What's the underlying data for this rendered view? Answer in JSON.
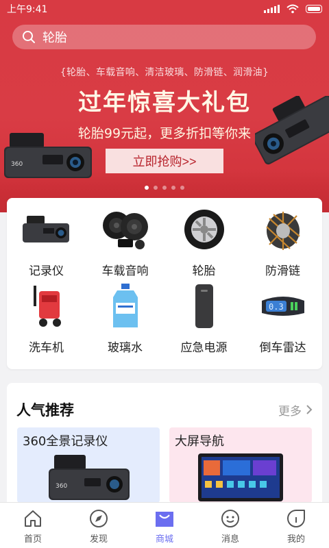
{
  "statusbar": {
    "time": "上午9:41"
  },
  "search": {
    "text": "轮胎",
    "icon": "search-icon"
  },
  "banner": {
    "tags": "{轮胎、车载音响、清洁玻璃、防滑链、润滑油}",
    "title": "过年惊喜大礼包",
    "subtitle": "轮胎99元起，更多折扣等你来",
    "cta": "立即抢购>>",
    "slide_count": 5,
    "active_slide": 1
  },
  "categories": [
    {
      "label": "记录仪",
      "icon": "dashcam-icon"
    },
    {
      "label": "车载音响",
      "icon": "speaker-icon"
    },
    {
      "label": "轮胎",
      "icon": "tire-icon"
    },
    {
      "label": "防滑链",
      "icon": "snow-chain-icon"
    },
    {
      "label": "洗车机",
      "icon": "pressure-washer-icon"
    },
    {
      "label": "玻璃水",
      "icon": "washer-fluid-icon"
    },
    {
      "label": "应急电源",
      "icon": "power-bank-icon"
    },
    {
      "label": "倒车雷达",
      "icon": "parking-sensor-icon"
    }
  ],
  "recommend": {
    "title": "人气推荐",
    "more": "更多",
    "items": [
      {
        "label": "360全景记录仪"
      },
      {
        "label": "大屏导航"
      }
    ]
  },
  "tabs": [
    {
      "label": "首页",
      "icon": "home-icon",
      "active": false
    },
    {
      "label": "发现",
      "icon": "compass-icon",
      "active": false
    },
    {
      "label": "商城",
      "icon": "shopping-bag-icon",
      "active": true
    },
    {
      "label": "消息",
      "icon": "chat-icon",
      "active": false
    },
    {
      "label": "我的",
      "icon": "profile-icon",
      "active": false
    }
  ],
  "colors": {
    "banner": "#d83a43",
    "accent": "#6b6ef0",
    "cta_bg": "#f9e0e0",
    "cta_text": "#b8242d"
  }
}
